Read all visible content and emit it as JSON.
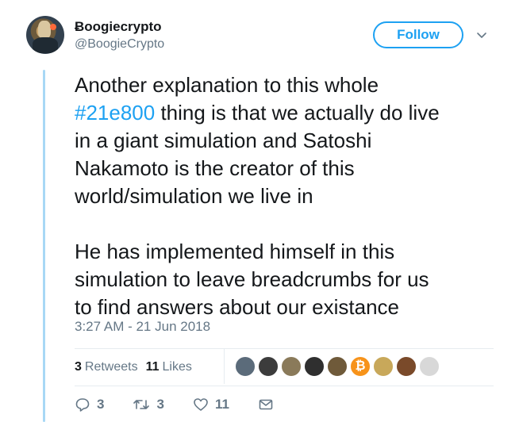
{
  "author": {
    "name": "Ƀoogiecrypto",
    "handle": "@BoogieCrypto"
  },
  "follow_button": {
    "label": "Follow"
  },
  "tweet": {
    "line_1_before": "Another explanation to this whole",
    "hashtag": "#21e800",
    "line_2_after": " thing is that we actually do live",
    "line_3": "in a giant simulation and Satoshi",
    "line_4": "Nakamoto is the creator of this",
    "line_5": "world/simulation we live in",
    "line_6": "He has implemented himself in this",
    "line_7": "simulation to leave breadcrumbs for us",
    "line_8": "to find answers about our existance"
  },
  "timestamp": "3:27 AM - 21 Jun 2018",
  "stats": {
    "retweets_count": "3",
    "retweets_label": "Retweets",
    "likes_count": "11",
    "likes_label": "Likes"
  },
  "likers": [
    {
      "color": "#5b6b7a"
    },
    {
      "color": "#3c3c3c"
    },
    {
      "color": "#8a7a5a"
    },
    {
      "color": "#2f2f2f"
    },
    {
      "color": "#6f5a3a"
    },
    {
      "color": "#f7931a",
      "symbol": "₿"
    },
    {
      "color": "#c8a85a"
    },
    {
      "color": "#7a4a2a"
    },
    {
      "color": "#d8d8d8"
    }
  ],
  "actions": {
    "reply_count": "3",
    "retweet_count": "3",
    "like_count": "11"
  },
  "colors": {
    "accent": "#1da1f2",
    "muted": "#657786",
    "thread_line": "#a8d8f5"
  }
}
